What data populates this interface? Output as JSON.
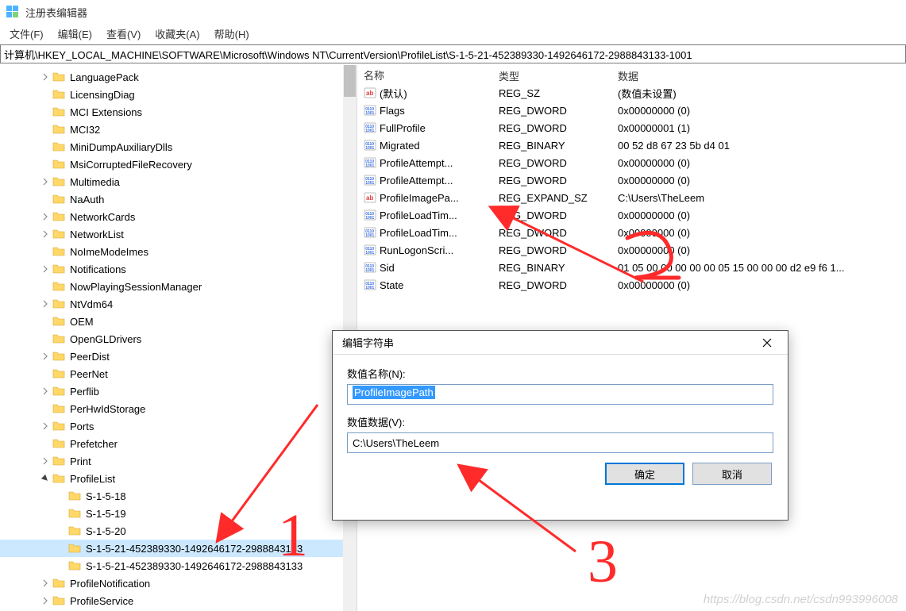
{
  "window": {
    "title": "注册表编辑器"
  },
  "menu": {
    "file": "文件(F)",
    "edit": "编辑(E)",
    "view": "查看(V)",
    "fav": "收藏夹(A)",
    "help": "帮助(H)"
  },
  "address": "计算机\\HKEY_LOCAL_MACHINE\\SOFTWARE\\Microsoft\\Windows NT\\CurrentVersion\\ProfileList\\S-1-5-21-452389330-1492646172-2988843133-1001",
  "cols": {
    "name": "名称",
    "type": "类型",
    "data": "数据"
  },
  "tree": [
    {
      "d": 2,
      "c": "closed",
      "t": "LanguagePack"
    },
    {
      "d": 2,
      "c": "none",
      "t": "LicensingDiag"
    },
    {
      "d": 2,
      "c": "none",
      "t": "MCI Extensions"
    },
    {
      "d": 2,
      "c": "none",
      "t": "MCI32"
    },
    {
      "d": 2,
      "c": "none",
      "t": "MiniDumpAuxiliaryDlls"
    },
    {
      "d": 2,
      "c": "none",
      "t": "MsiCorruptedFileRecovery"
    },
    {
      "d": 2,
      "c": "closed",
      "t": "Multimedia"
    },
    {
      "d": 2,
      "c": "none",
      "t": "NaAuth"
    },
    {
      "d": 2,
      "c": "closed",
      "t": "NetworkCards"
    },
    {
      "d": 2,
      "c": "closed",
      "t": "NetworkList"
    },
    {
      "d": 2,
      "c": "none",
      "t": "NoImeModeImes"
    },
    {
      "d": 2,
      "c": "closed",
      "t": "Notifications"
    },
    {
      "d": 2,
      "c": "none",
      "t": "NowPlayingSessionManager"
    },
    {
      "d": 2,
      "c": "closed",
      "t": "NtVdm64"
    },
    {
      "d": 2,
      "c": "none",
      "t": "OEM"
    },
    {
      "d": 2,
      "c": "none",
      "t": "OpenGLDrivers"
    },
    {
      "d": 2,
      "c": "closed",
      "t": "PeerDist"
    },
    {
      "d": 2,
      "c": "none",
      "t": "PeerNet"
    },
    {
      "d": 2,
      "c": "closed",
      "t": "Perflib"
    },
    {
      "d": 2,
      "c": "none",
      "t": "PerHwIdStorage"
    },
    {
      "d": 2,
      "c": "closed",
      "t": "Ports"
    },
    {
      "d": 2,
      "c": "none",
      "t": "Prefetcher"
    },
    {
      "d": 2,
      "c": "closed",
      "t": "Print"
    },
    {
      "d": 2,
      "c": "open",
      "t": "ProfileList"
    },
    {
      "d": 3,
      "c": "none",
      "t": "S-1-5-18"
    },
    {
      "d": 3,
      "c": "none",
      "t": "S-1-5-19"
    },
    {
      "d": 3,
      "c": "none",
      "t": "S-1-5-20"
    },
    {
      "d": 3,
      "c": "none",
      "t": "S-1-5-21-452389330-1492646172-2988843133",
      "selected": true
    },
    {
      "d": 3,
      "c": "none",
      "t": "S-1-5-21-452389330-1492646172-2988843133"
    },
    {
      "d": 2,
      "c": "closed",
      "t": "ProfileNotification"
    },
    {
      "d": 2,
      "c": "closed",
      "t": "ProfileService"
    }
  ],
  "values": [
    {
      "icon": "str",
      "name": "(默认)",
      "type": "REG_SZ",
      "data": "(数值未设置)"
    },
    {
      "icon": "bin",
      "name": "Flags",
      "type": "REG_DWORD",
      "data": "0x00000000 (0)"
    },
    {
      "icon": "bin",
      "name": "FullProfile",
      "type": "REG_DWORD",
      "data": "0x00000001 (1)"
    },
    {
      "icon": "bin",
      "name": "Migrated",
      "type": "REG_BINARY",
      "data": "00 52 d8 67 23 5b d4 01"
    },
    {
      "icon": "bin",
      "name": "ProfileAttempt...",
      "type": "REG_DWORD",
      "data": "0x00000000 (0)"
    },
    {
      "icon": "bin",
      "name": "ProfileAttempt...",
      "type": "REG_DWORD",
      "data": "0x00000000 (0)"
    },
    {
      "icon": "str",
      "name": "ProfileImagePa...",
      "type": "REG_EXPAND_SZ",
      "data": "C:\\Users\\TheLeem"
    },
    {
      "icon": "bin",
      "name": "ProfileLoadTim...",
      "type": "REG_DWORD",
      "data": "0x00000000 (0)"
    },
    {
      "icon": "bin",
      "name": "ProfileLoadTim...",
      "type": "REG_DWORD",
      "data": "0x00000000 (0)"
    },
    {
      "icon": "bin",
      "name": "RunLogonScri...",
      "type": "REG_DWORD",
      "data": "0x00000000 (0)"
    },
    {
      "icon": "bin",
      "name": "Sid",
      "type": "REG_BINARY",
      "data": "01 05 00 00 00 00 00 05 15 00 00 00 d2 e9 f6 1..."
    },
    {
      "icon": "bin",
      "name": "State",
      "type": "REG_DWORD",
      "data": "0x00000000 (0)"
    }
  ],
  "dialog": {
    "title": "编辑字符串",
    "name_label": "数值名称(N):",
    "name_value": "ProfileImagePath",
    "data_label": "数值数据(V):",
    "data_value": "C:\\Users\\TheLeem",
    "ok": "确定",
    "cancel": "取消"
  },
  "watermark": "https://blog.csdn.net/csdn993996008"
}
